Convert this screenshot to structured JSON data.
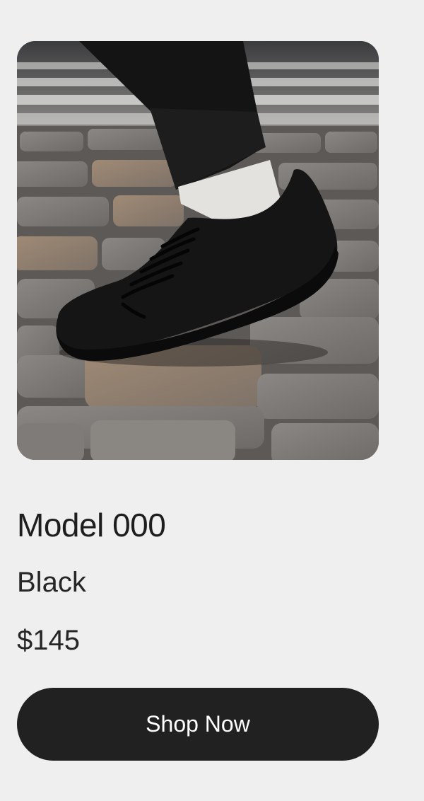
{
  "product": {
    "name": "Model 000",
    "color": "Black",
    "price": "$145",
    "image_icon": "shoe-photo"
  },
  "cta": {
    "label": "Shop Now"
  },
  "colors": {
    "background": "#efefef",
    "button": "#212121",
    "button_text": "#ffffff",
    "text": "#1e1e1e"
  }
}
